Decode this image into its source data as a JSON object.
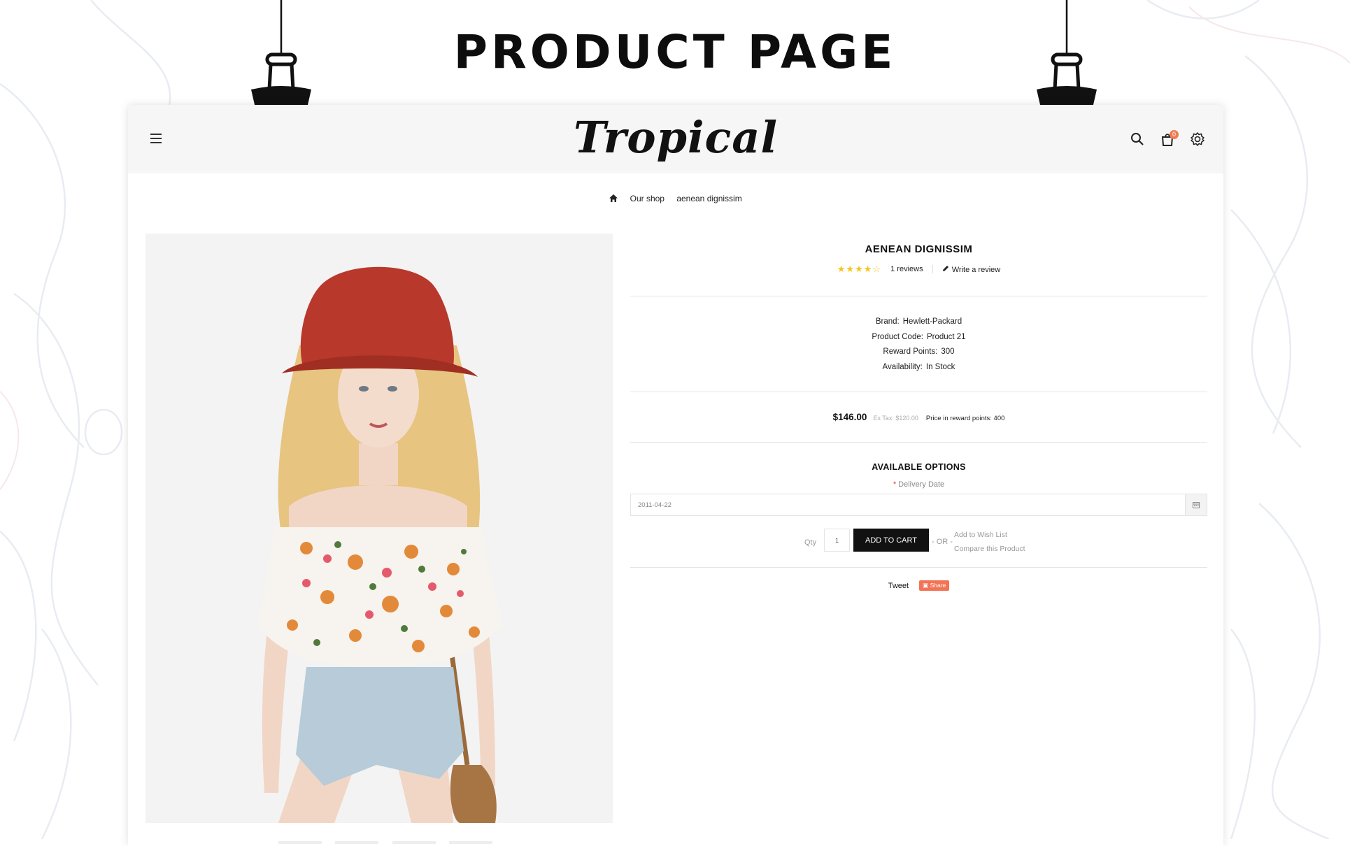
{
  "banner": {
    "title": "PRODUCT PAGE"
  },
  "header": {
    "logo": "Tropical",
    "cart_count": "0"
  },
  "breadcrumb": {
    "items": [
      "Our shop",
      "aenean dignissim"
    ]
  },
  "product": {
    "title": "AENEAN DIGNISSIM",
    "rating": 4,
    "rating_max": 5,
    "reviews": "1 reviews",
    "write_review": "Write a review",
    "specs": [
      {
        "label": "Brand:",
        "value": "Hewlett-Packard"
      },
      {
        "label": "Product Code:",
        "value": "Product 21"
      },
      {
        "label": "Reward Points:",
        "value": "300"
      },
      {
        "label": "Availability:",
        "value": "In Stock"
      }
    ],
    "price": "$146.00",
    "ex_tax": "Ex Tax: $120.00",
    "reward_price": "Price in reward points: 400"
  },
  "options": {
    "title": "AVAILABLE OPTIONS",
    "required_mark": "*",
    "delivery_label": "Delivery Date",
    "delivery_value": "2011-04-22"
  },
  "cart": {
    "qty_label": "Qty",
    "qty_value": "1",
    "add_to_cart": "ADD TO CART",
    "or_text": "- OR -",
    "wishlist": "Add to Wish List",
    "compare": "Compare this Product"
  },
  "social": {
    "tweet": "Tweet",
    "share": "Share"
  },
  "colors": {
    "accent": "#f07b50",
    "share": "#f27456",
    "star": "#f5c518",
    "button": "#111111"
  },
  "icons": [
    "hamburger-icon",
    "search-icon",
    "cart-icon",
    "gear-icon",
    "home-icon",
    "pencil-icon",
    "calendar-icon",
    "share-icon"
  ]
}
